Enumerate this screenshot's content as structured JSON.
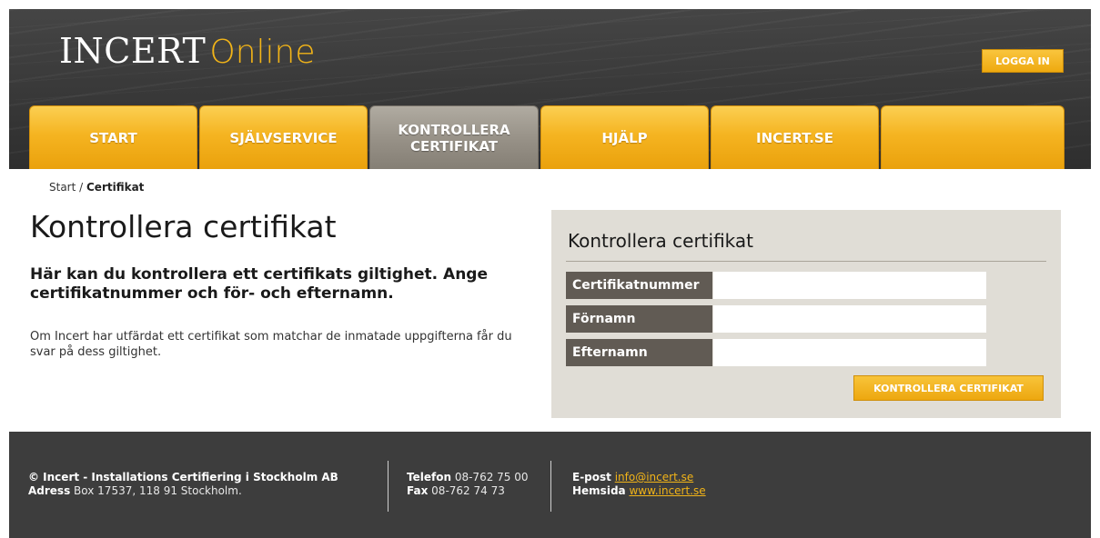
{
  "header": {
    "logo_main": "INCERT",
    "logo_sub": "Online",
    "login_label": "LOGGA IN"
  },
  "nav": {
    "tabs": [
      {
        "line1": "START",
        "line2": ""
      },
      {
        "line1": "SJÄLVSERVICE",
        "line2": ""
      },
      {
        "line1": "KONTROLLERA",
        "line2": "CERTIFIKAT"
      },
      {
        "line1": "HJÄLP",
        "line2": ""
      },
      {
        "line1": "INCERT.SE",
        "line2": ""
      },
      {
        "line1": "",
        "line2": ""
      }
    ],
    "active_index": 2
  },
  "breadcrumb": {
    "home": "Start",
    "separator": " / ",
    "current": "Certifikat"
  },
  "main": {
    "title": "Kontrollera certifikat",
    "lead": "Här kan du kontrollera ett certifikats giltighet. Ange certifikatnummer och för- och efternamn.",
    "body": "Om Incert har utfärdat ett certifikat som matchar de inmatade uppgifterna får du svar på dess giltighet."
  },
  "form": {
    "title": "Kontrollera certifikat",
    "fields": [
      {
        "label": "Certifikatnummer",
        "value": "",
        "placeholder": ""
      },
      {
        "label": "Förnamn",
        "value": "",
        "placeholder": ""
      },
      {
        "label": "Efternamn",
        "value": "",
        "placeholder": ""
      }
    ],
    "submit_label": "KONTROLLERA CERTIFIKAT"
  },
  "footer": {
    "company": "© Incert - Installations Certifiering i Stockholm AB",
    "address_label": "Adress",
    "address_value": "Box 17537, 118 91 Stockholm.",
    "phone_label": "Telefon",
    "phone_value": "08-762 75 00",
    "fax_label": "Fax",
    "fax_value": "08-762 74 73",
    "email_label": "E-post",
    "email_value": "info@incert.se",
    "web_label": "Hemsida",
    "web_value": "www.incert.se"
  },
  "colors": {
    "accent_gold": "#f2b418",
    "header_dark": "#383838",
    "active_tab_gray": "#969086",
    "panel_bg": "#e0ddd6",
    "label_bg": "#615b54",
    "footer_bg": "#3d3d3d"
  }
}
